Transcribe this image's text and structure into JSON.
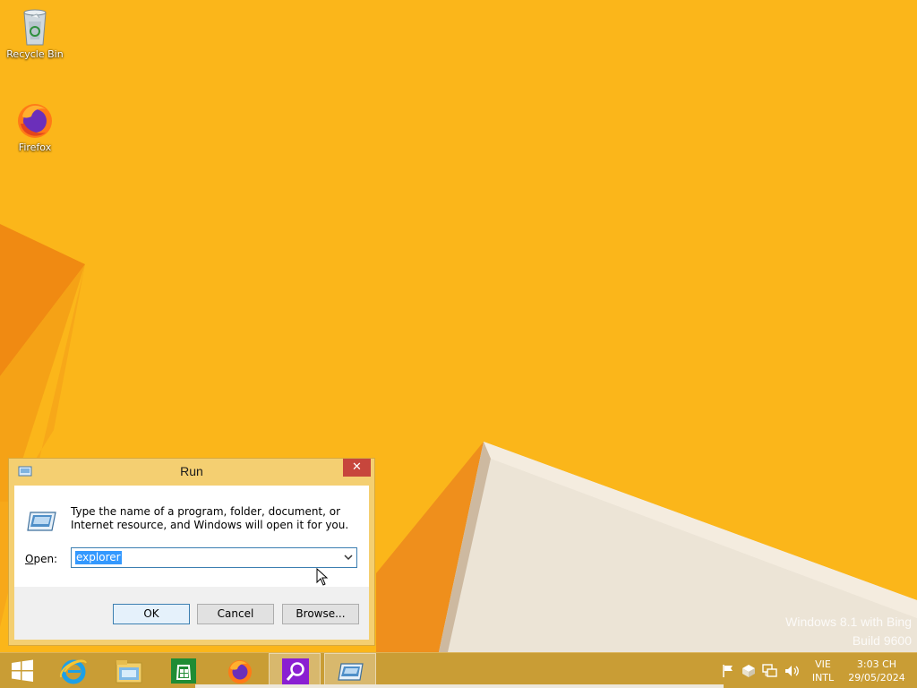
{
  "desktop": {
    "icons": [
      {
        "label": "Recycle Bin",
        "icon": "recycle-bin-icon"
      },
      {
        "label": "Firefox",
        "icon": "firefox-icon"
      }
    ],
    "watermark": {
      "line1": "Windows 8.1 with Bing",
      "line2": "Build 9600"
    },
    "background_color": "#fbb61a"
  },
  "run_dialog": {
    "title": "Run",
    "close_glyph": "✕",
    "description": "Type the name of a program, folder, document, or Internet resource, and Windows will open it for you.",
    "open_label_accel": "O",
    "open_label_rest": "pen:",
    "open_value": "explorer",
    "buttons": {
      "ok": "OK",
      "cancel": "Cancel",
      "browse": "Browse..."
    }
  },
  "taskbar": {
    "items": [
      "start-icon",
      "internet-explorer-icon",
      "file-explorer-icon",
      "store-icon",
      "firefox-icon",
      "search-app-icon",
      "run-icon"
    ],
    "language": {
      "top": "VIE",
      "bottom": "INTL"
    },
    "clock": {
      "time": "3:03 CH",
      "date": "29/05/2024"
    },
    "accent_color": "#c99d35"
  }
}
